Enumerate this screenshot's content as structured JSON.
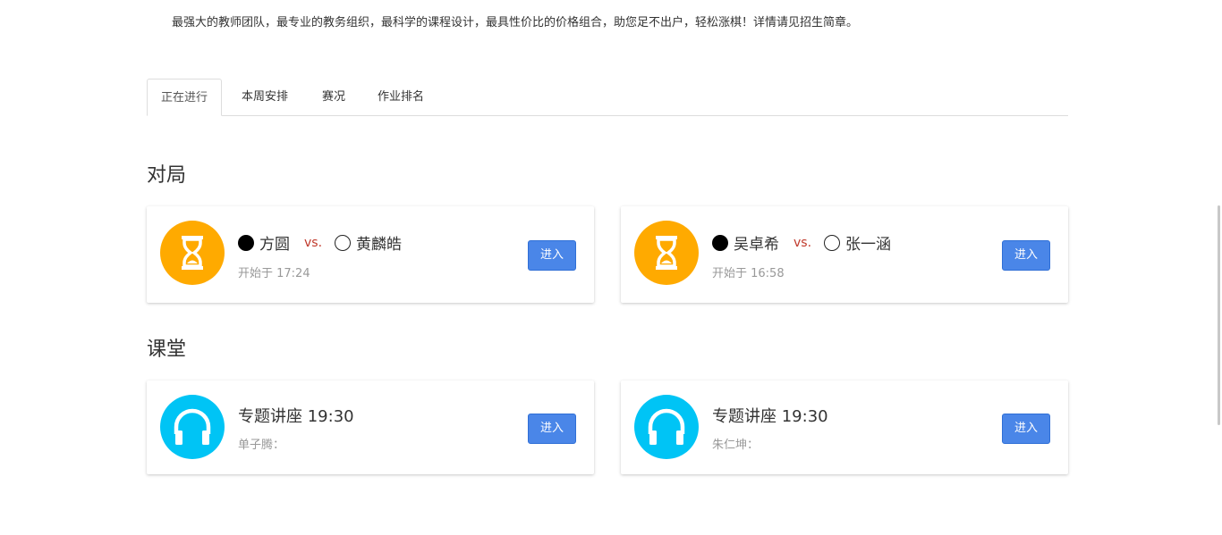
{
  "intro_text": "最强大的教师团队，最专业的教务组织，最科学的课程设计，最具性价比的价格组合，助您足不出户，轻松涨棋！详情请见招生简章。",
  "tabs": [
    {
      "label": "正在进行",
      "active": true
    },
    {
      "label": "本周安排",
      "active": false
    },
    {
      "label": "赛况",
      "active": false
    },
    {
      "label": "作业排名",
      "active": false
    }
  ],
  "games_section": {
    "title": "对局",
    "icon": "hourglass-icon",
    "icon_color": "#ffaa00",
    "items": [
      {
        "black_player": "方圆",
        "vs": "vs.",
        "white_player": "黄麟皓",
        "started": "开始于 17:24",
        "button": "进入"
      },
      {
        "black_player": "吴卓希",
        "vs": "vs.",
        "white_player": "张一涵",
        "started": "开始于 16:58",
        "button": "进入"
      }
    ]
  },
  "classes_section": {
    "title": "课堂",
    "icon": "headphones-icon",
    "icon_color": "#00c4f5",
    "items": [
      {
        "title": "专题讲座 19:30",
        "teacher": "单子腾：",
        "button": "进入"
      },
      {
        "title": "专题讲座 19:30",
        "teacher": "朱仁坤：",
        "button": "进入"
      }
    ]
  },
  "colors": {
    "button": "#4a86e8",
    "vs": "#c0392b"
  }
}
